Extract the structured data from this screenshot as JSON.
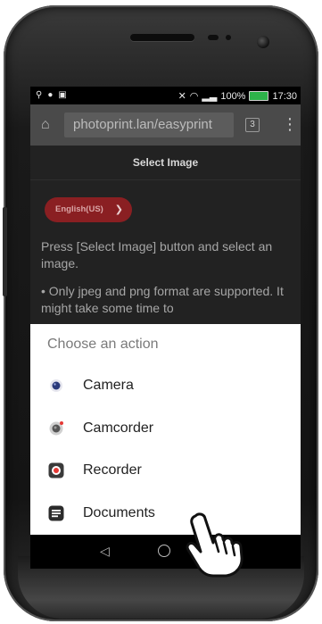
{
  "status_bar": {
    "battery_text": "100%",
    "time": "17:30",
    "battery_color": "#2db34a"
  },
  "browser": {
    "url": "photoprint.lan/easyprint",
    "tab_count": "3"
  },
  "page": {
    "title": "Select Image",
    "language": "English(US)",
    "instruction": "Press [Select Image] button and select an image.",
    "note": "• Only jpeg and png format are supported. It might take some time to"
  },
  "dialog": {
    "title": "Choose an action",
    "actions": [
      {
        "label": "Camera",
        "icon": "camera-icon"
      },
      {
        "label": "Camcorder",
        "icon": "camcorder-icon"
      },
      {
        "label": "Recorder",
        "icon": "recorder-icon"
      },
      {
        "label": "Documents",
        "icon": "documents-icon"
      }
    ]
  },
  "colors": {
    "accent": "#8a1f22",
    "urlbar": "#4a4a4a",
    "page_bg": "#222222"
  }
}
